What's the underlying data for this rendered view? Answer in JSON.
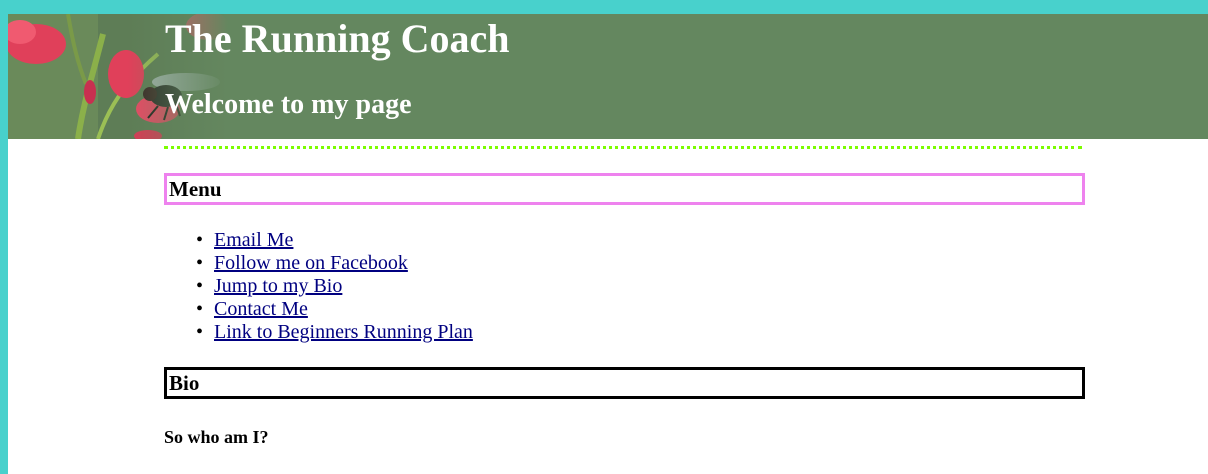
{
  "header": {
    "title": "The Running Coach",
    "subtitle": "Welcome to my page"
  },
  "menu": {
    "heading": "Menu",
    "items": [
      {
        "label": "Email Me"
      },
      {
        "label": "Follow me on Facebook"
      },
      {
        "label": "Jump to my Bio"
      },
      {
        "label": "Contact Me"
      },
      {
        "label": "Link to Beginners Running Plan"
      }
    ]
  },
  "bio": {
    "heading": "Bio",
    "question": "So who am I?"
  },
  "colors": {
    "frame": "#48d1cc",
    "banner": "#64875f",
    "dotted_rule": "#7cfc00",
    "menu_border": "#ee82ee",
    "bio_border": "#000000",
    "link": "#000080"
  }
}
